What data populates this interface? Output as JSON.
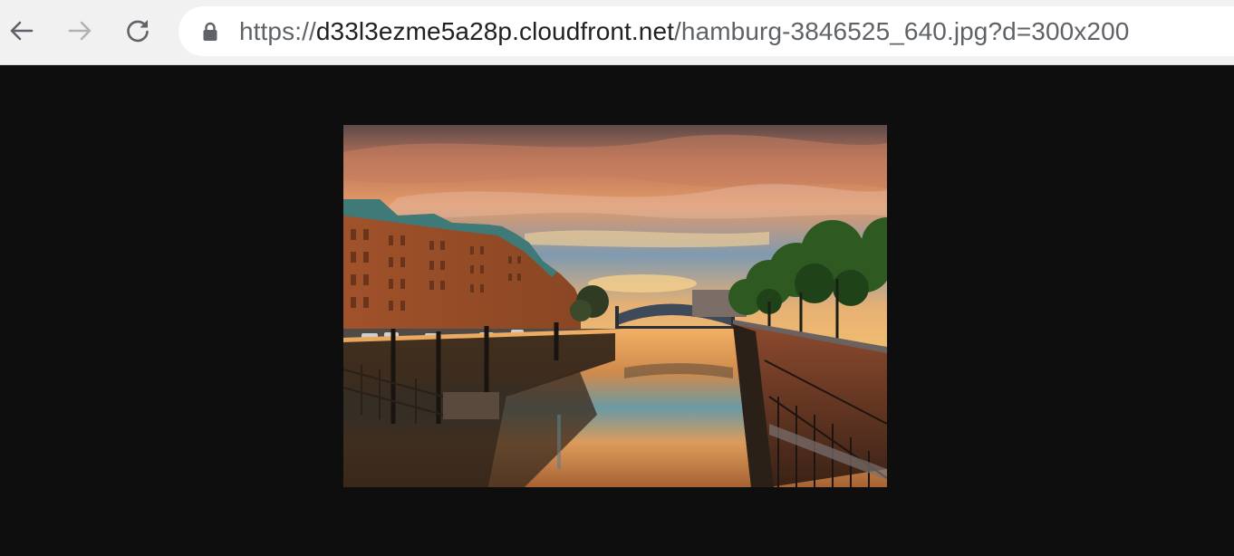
{
  "browser": {
    "back_icon": "arrow-left-icon",
    "forward_icon": "arrow-right-icon",
    "reload_icon": "reload-icon",
    "secure_icon": "lock-icon",
    "url_scheme": "https://",
    "url_host": "d33l3ezme5a28p.cloudfront.net",
    "url_path": "/hamburg-3846525_640.jpg?d=300x200"
  },
  "image": {
    "subject": "sunset over Hamburg Speicherstadt canal with brick warehouses, iron bridge and trees"
  },
  "colors": {
    "toolbar_bg": "#f1f1f2",
    "viewer_bg": "#0e0e0e",
    "url_dim": "#5f6368",
    "url_host": "#202124"
  }
}
